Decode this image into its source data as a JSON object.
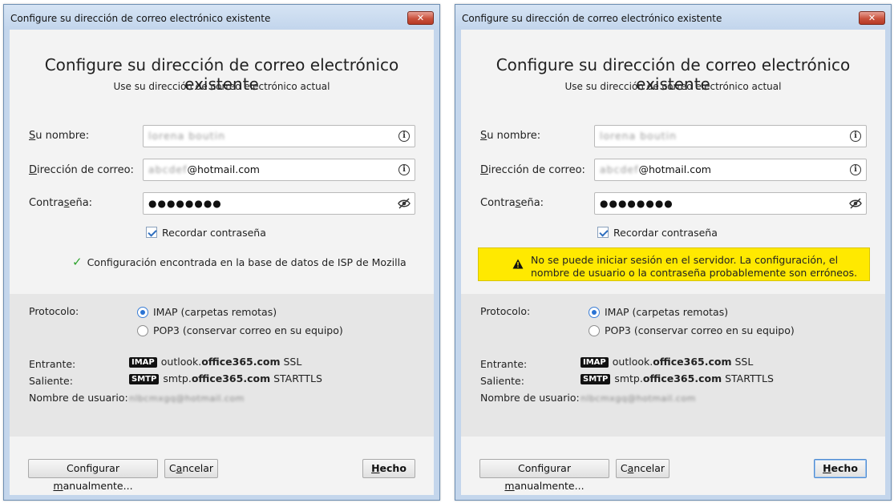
{
  "dialogs": [
    {
      "title": "Configure su dirección de correo electrónico existente",
      "close_label": "✕",
      "heading": "Configure su dirección de correo electrónico existente",
      "subheading": "Use su dirección de correo electrónico actual",
      "name_label_pre": "",
      "name_label_ul": "S",
      "name_label_post": "u nombre:",
      "name_value": "lorena boutin",
      "email_label_pre": "",
      "email_label_ul": "D",
      "email_label_post": "irección de correo:",
      "email_blur": "abcdef",
      "email_suffix": "@hotmail.com",
      "password_label_pre": "Contra",
      "password_label_ul": "s",
      "password_label_post": "eña:",
      "password_value": "●●●●●●●●",
      "remember_label": "Recordar contraseña",
      "status_message": "Configuración encontrada en la base de datos de ISP de Mozilla",
      "protocol_label": "Protocolo:",
      "imap_option": "IMAP (carpetas remotas)",
      "pop3_option": "POP3 (conservar correo en su equipo)",
      "incoming_label": "Entrante:",
      "incoming_badge": "IMAP",
      "incoming_host_pre": "outlook.",
      "incoming_host_bold": "office365.com",
      "incoming_security": "SSL",
      "outgoing_label": "Saliente:",
      "outgoing_badge": "SMTP",
      "outgoing_host_pre": "smtp.",
      "outgoing_host_bold": "office365.com",
      "outgoing_security": "STARTTLS",
      "username_label": "Nombre de usuario:",
      "username_value": "nlbcmxgq@hotmail.com",
      "manual_btn_pre": "Configurar ",
      "manual_btn_ul": "m",
      "manual_btn_post": "anualmente...",
      "cancel_btn_pre": "C",
      "cancel_btn_ul": "a",
      "cancel_btn_post": "ncelar",
      "done_btn_pre": "",
      "done_btn_ul": "H",
      "done_btn_post": "echo"
    },
    {
      "title": "Configure su dirección de correo electrónico existente",
      "close_label": "✕",
      "heading": "Configure su dirección de correo electrónico existente",
      "subheading": "Use su dirección de correo electrónico actual",
      "name_label_pre": "",
      "name_label_ul": "S",
      "name_label_post": "u nombre:",
      "name_value": "lorena boutin",
      "email_label_pre": "",
      "email_label_ul": "D",
      "email_label_post": "irección de correo:",
      "email_blur": "abcdef",
      "email_suffix": "@hotmail.com",
      "password_label_pre": "Contra",
      "password_label_ul": "s",
      "password_label_post": "eña:",
      "password_value": "●●●●●●●●",
      "remember_label": "Recordar contraseña",
      "warning_line1": "No se puede iniciar sesión en el servidor. La configuración, el",
      "warning_line2": "nombre de usuario o la contraseña probablemente son erróneos.",
      "protocol_label": "Protocolo:",
      "imap_option": "IMAP (carpetas remotas)",
      "pop3_option": "POP3 (conservar correo en su equipo)",
      "incoming_label": "Entrante:",
      "incoming_badge": "IMAP",
      "incoming_host_pre": "outlook.",
      "incoming_host_bold": "office365.com",
      "incoming_security": "SSL",
      "outgoing_label": "Saliente:",
      "outgoing_badge": "SMTP",
      "outgoing_host_pre": "smtp.",
      "outgoing_host_bold": "office365.com",
      "outgoing_security": "STARTTLS",
      "username_label": "Nombre de usuario:",
      "username_value": "nlbcmxgq@hotmail.com",
      "manual_btn_pre": "Configurar ",
      "manual_btn_ul": "m",
      "manual_btn_post": "anualmente...",
      "cancel_btn_pre": "C",
      "cancel_btn_ul": "a",
      "cancel_btn_post": "ncelar",
      "done_btn_pre": "",
      "done_btn_ul": "H",
      "done_btn_post": "echo"
    }
  ],
  "colors": {
    "warning_bg": "#ffe900",
    "success_check": "#2ea32e",
    "radio_selected": "#2a73d4",
    "title_bar": "#c4d6ec",
    "close_button": "#c9523d"
  },
  "icons": {
    "info": "info-circle-icon",
    "password_toggle": "eye-slash-icon",
    "success": "checkmark-icon",
    "warning": "warning-triangle-icon",
    "close": "close-icon"
  }
}
